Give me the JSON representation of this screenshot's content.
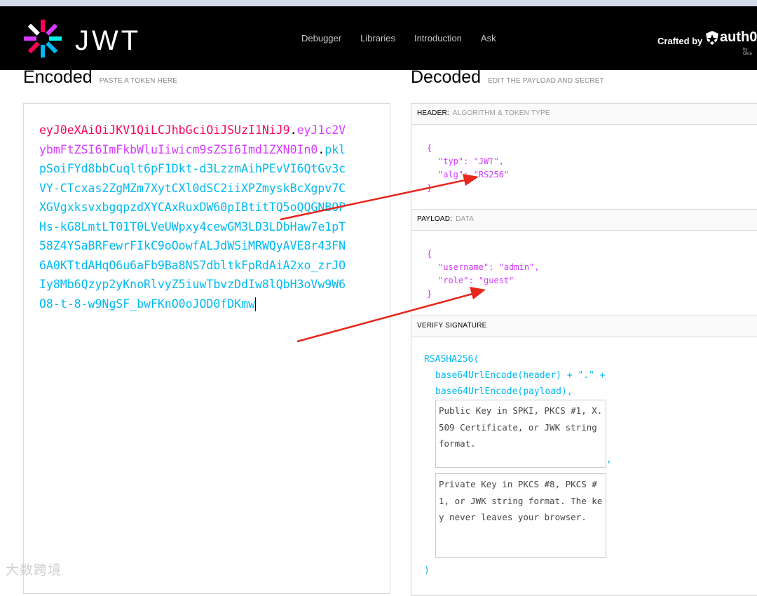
{
  "browser": {
    "top_strip_color": "#d3dbe9"
  },
  "nav": {
    "logo_text": "JWT",
    "links": [
      "Debugger",
      "Libraries",
      "Introduction",
      "Ask"
    ],
    "crafted_by": "Crafted by",
    "brand": "auth0",
    "brand_sub": "by Okta"
  },
  "encoded": {
    "title": "Encoded",
    "subtitle": "PASTE A TOKEN HERE",
    "token_header": "eyJ0eXAiOiJKV1QiLCJhbGciOiJSUzI1NiJ9",
    "token_payload": "eyJ1c2VybmFtZSI6ImFkbWluIiwicm9sZSI6Imd1ZXN0In0",
    "token_signature": "pklpSoiFYd8bbCuqlt6pF1Dkt-d3LzzmAihPEvVI6QtGv3cVY-CTcxas2ZgMZm7XytCXl0dSC2iiXPZmyskBcXgpv7CXGVgxksvxbgqpzdXYCAxRuxDW60pIBtitTQ5oQQGNBOPHs-kG8LmtLT01T0LVeUWpxy4cewGM3LD3LDbHaw7e1pT58Z4YSaBRFewrFIkC9oOowfALJdWSiMRWQyAVE8r43FN6A0KTtdAHqO6u6aFb9Ba8NS7dbltkFpRdAiA2xo_zrJOIy8Mb6Qzyp2yKnoRlvyZ5iuwTbvzDdIw8lQbH3oVw9W6O8-t-8-w9NgSF_bwFKnO0oJOD0fDKmw"
  },
  "decoded": {
    "title": "Decoded",
    "subtitle": "EDIT THE PAYLOAD AND SECRET",
    "header": {
      "label": "HEADER:",
      "sub": "ALGORITHM & TOKEN TYPE",
      "open": "{",
      "lines": [
        "\"typ\": \"JWT\",",
        "\"alg\": \"RS256\""
      ],
      "close": "}"
    },
    "payload": {
      "label": "PAYLOAD:",
      "sub": "DATA",
      "open": "{",
      "lines": [
        "\"username\": \"admin\",",
        "\"role\": \"guest\""
      ],
      "close": "}"
    },
    "verify": {
      "label": "VERIFY SIGNATURE",
      "fn": "RSASHA256(",
      "line1": "base64UrlEncode(header) + \".\" +",
      "line2": "base64UrlEncode(payload),",
      "public_key_placeholder": "Public Key in SPKI, PKCS #1, X.509 Certificate, or JWK string format.",
      "comma": ",",
      "private_key_placeholder": "Private Key in PKCS #8, PKCS #1, or JWK string format. The key never leaves your browser.",
      "close": ")"
    }
  },
  "watermark": "大数跨境",
  "colors": {
    "header_red": "#fb015b",
    "payload_purple": "#d63aff",
    "signature_blue": "#00b9f1",
    "annotation_arrow": "#e8261c"
  }
}
